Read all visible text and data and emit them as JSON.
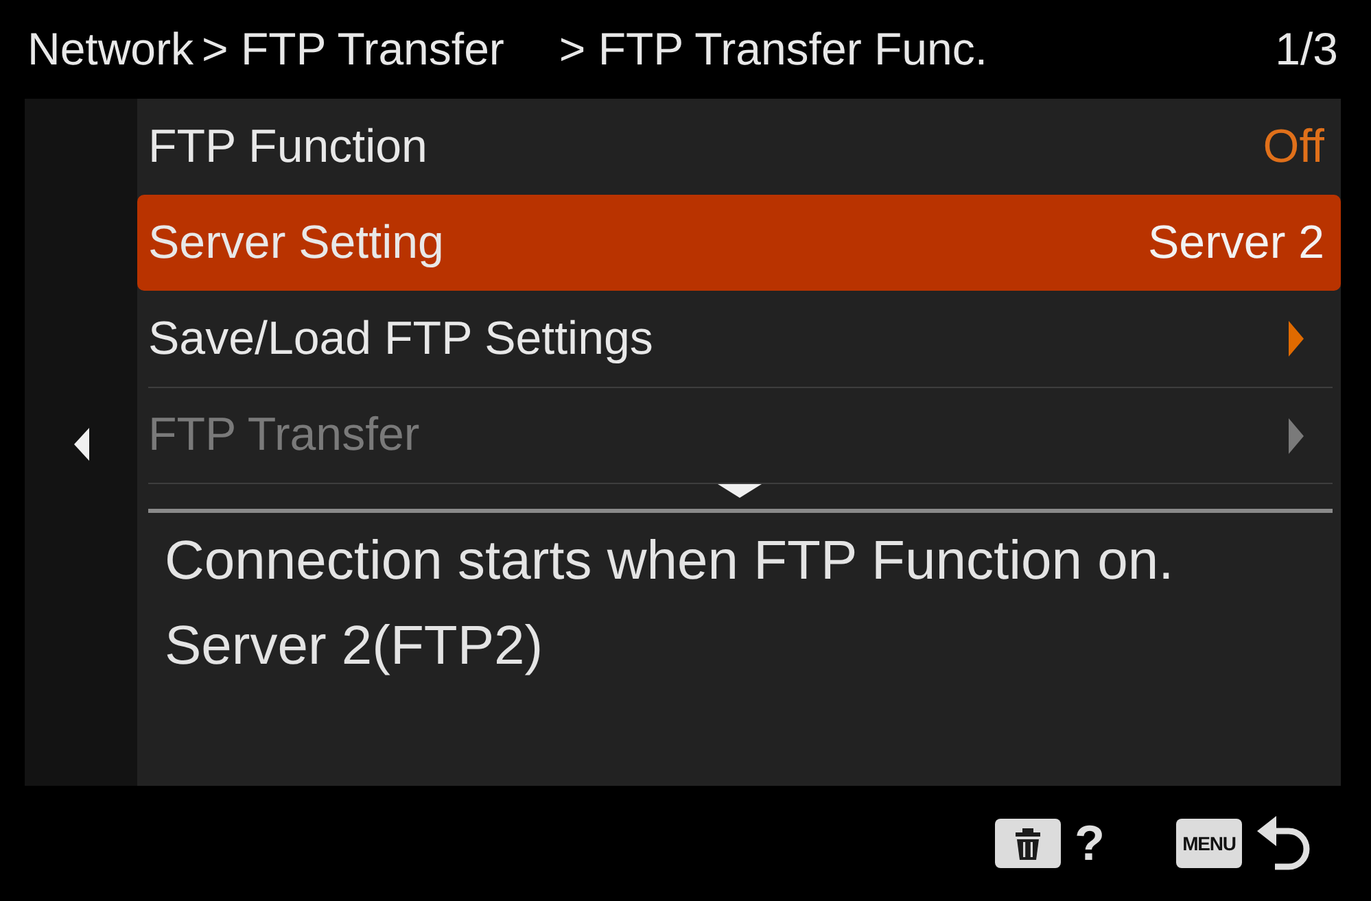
{
  "header": {
    "breadcrumb": [
      "Network",
      "> FTP Transfer",
      "> FTP Transfer Func."
    ],
    "page": "1/3"
  },
  "menu": {
    "items": [
      {
        "label": "FTP Function",
        "kind": "value",
        "value": "Off",
        "selected": false,
        "disabled": false
      },
      {
        "label": "Server Setting",
        "kind": "value",
        "value": "Server 2",
        "selected": true,
        "disabled": false
      },
      {
        "label": "Save/Load FTP Settings",
        "kind": "submenu",
        "selected": false,
        "disabled": false
      },
      {
        "label": "FTP Transfer",
        "kind": "submenu",
        "selected": false,
        "disabled": true
      }
    ]
  },
  "description": [
    "Connection starts when FTP Function on.",
    "Server 2(FTP2)"
  ],
  "footer": [
    {
      "items": [
        {
          "kind": "trash"
        },
        {
          "kind": "label",
          "text": "?"
        }
      ]
    },
    {
      "items": [
        {
          "kind": "key",
          "text": "MENU"
        },
        {
          "kind": "return"
        }
      ]
    }
  ]
}
